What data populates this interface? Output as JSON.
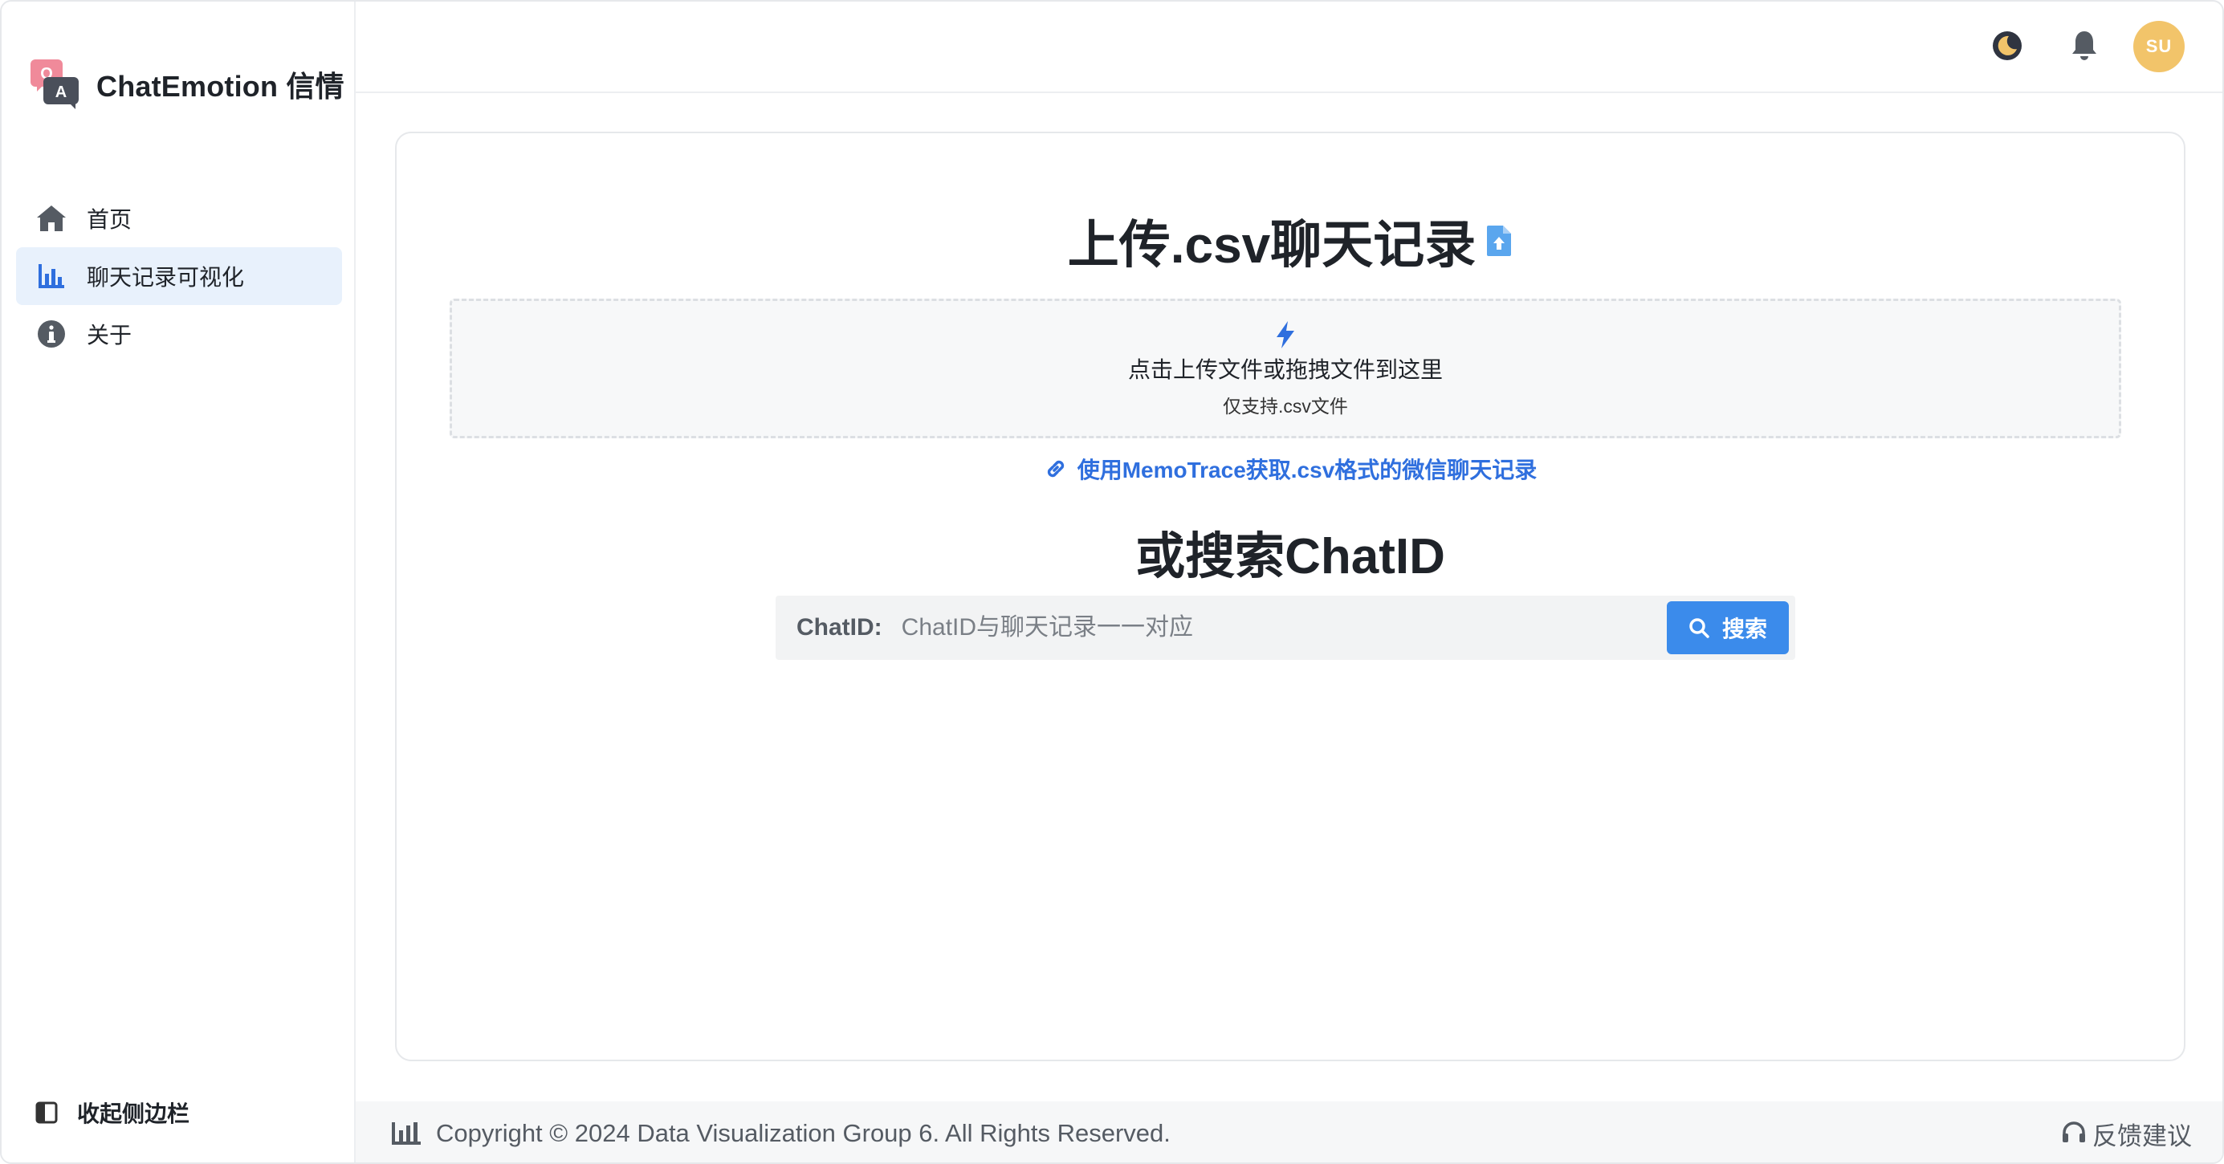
{
  "brand": {
    "name": "ChatEmotion 信情",
    "logo_q": "Q",
    "logo_a": "A"
  },
  "sidebar": {
    "items": [
      {
        "label": "首页",
        "icon": "home-icon",
        "active": false
      },
      {
        "label": "聊天记录可视化",
        "icon": "bar-chart-icon",
        "active": true
      },
      {
        "label": "关于",
        "icon": "info-icon",
        "active": false
      }
    ],
    "collapse_label": "收起侧边栏"
  },
  "header": {
    "avatar_text": "SU",
    "theme_icon": "moon-icon",
    "notify_icon": "bell-icon"
  },
  "upload": {
    "title": "上传.csv聊天记录",
    "drop_text": "点击上传文件或拖拽文件到这里",
    "drop_hint": "仅支持.csv文件",
    "link_text": "使用MemoTrace获取.csv格式的微信聊天记录"
  },
  "search": {
    "title": "或搜索ChatID",
    "label": "ChatID:",
    "placeholder": "ChatID与聊天记录一一对应",
    "button": "搜索"
  },
  "footer": {
    "copyright": "Copyright © 2024 Data Visualization Group 6. All Rights Reserved.",
    "feedback": "反馈建议"
  },
  "colors": {
    "accent": "#3b8beb",
    "active_bg": "#e8f1fc",
    "avatar": "#f2c46a",
    "link": "#2f6fde"
  }
}
